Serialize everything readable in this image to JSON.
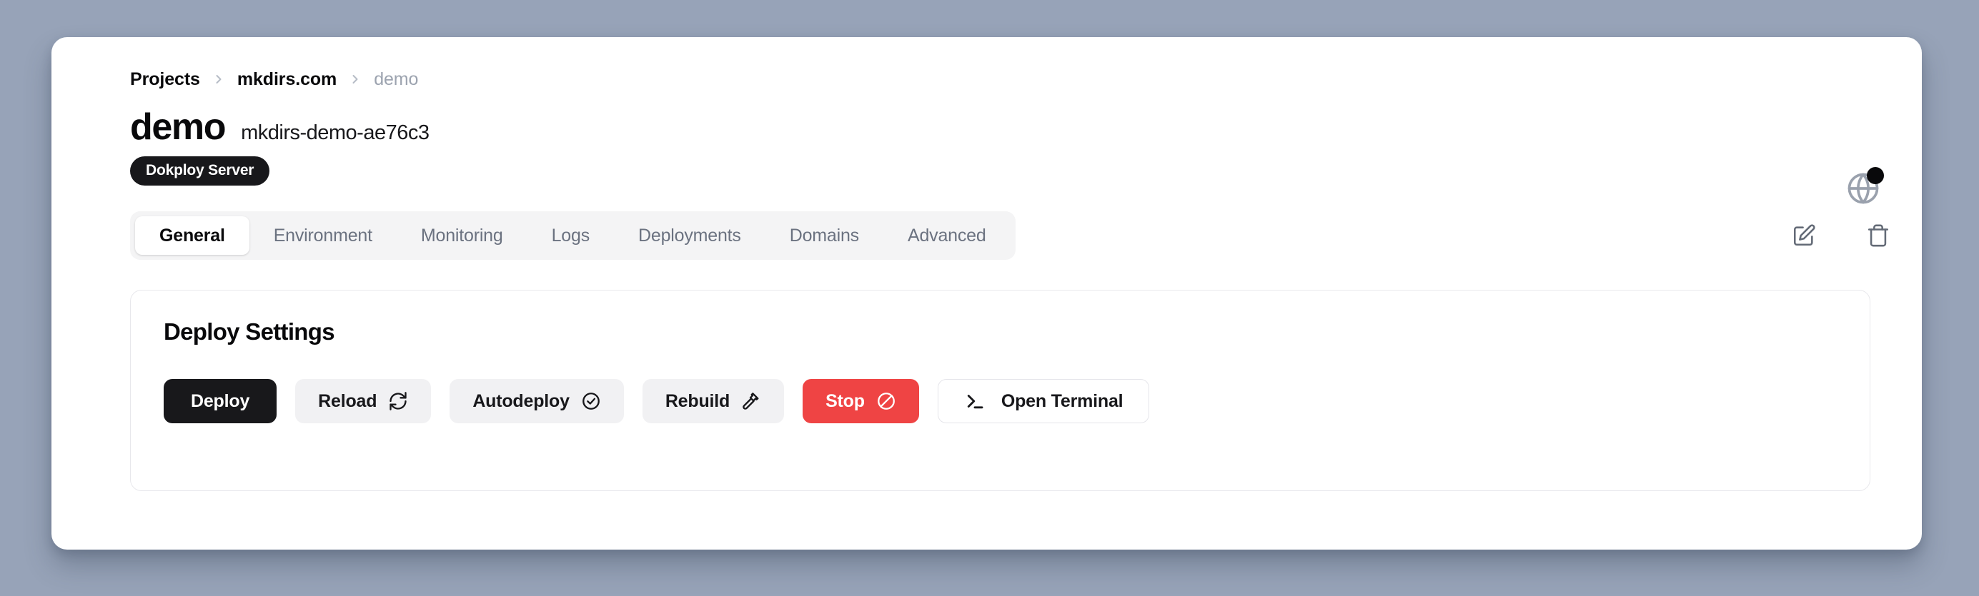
{
  "theme": {
    "page_background": "#97a3b8",
    "card_background": "#ffffff",
    "accent_dark": "#18181b",
    "danger": "#ef4444",
    "muted_text": "#6b7280",
    "panel_border": "#e8e8ec",
    "tabbar_background": "#f4f4f5"
  },
  "breadcrumb": {
    "items": [
      {
        "label": "Projects",
        "muted": false
      },
      {
        "label": "mkdirs.com",
        "muted": false
      },
      {
        "label": "demo",
        "muted": true
      }
    ],
    "separator_icon": "chevron-right-icon"
  },
  "header": {
    "title": "demo",
    "subtitle": "mkdirs-demo-ae76c3",
    "badge": "Dokploy Server",
    "globe_icon": "globe-icon",
    "globe_status_dot": "status-dot"
  },
  "tabs": {
    "items": [
      {
        "label": "General",
        "active": true
      },
      {
        "label": "Environment",
        "active": false
      },
      {
        "label": "Monitoring",
        "active": false
      },
      {
        "label": "Logs",
        "active": false
      },
      {
        "label": "Deployments",
        "active": false
      },
      {
        "label": "Domains",
        "active": false
      },
      {
        "label": "Advanced",
        "active": false
      }
    ],
    "actions": [
      {
        "name": "edit-button",
        "icon": "pencil-square-icon"
      },
      {
        "name": "delete-button",
        "icon": "trash-icon"
      }
    ]
  },
  "panel": {
    "title": "Deploy Settings",
    "buttons": [
      {
        "label": "Deploy",
        "icon": null,
        "style": "primary"
      },
      {
        "label": "Reload",
        "icon": "refresh-icon",
        "style": "secondary"
      },
      {
        "label": "Autodeploy",
        "icon": "check-circle-icon",
        "style": "secondary"
      },
      {
        "label": "Rebuild",
        "icon": "hammer-icon",
        "style": "secondary"
      },
      {
        "label": "Stop",
        "icon": "ban-icon",
        "style": "danger"
      },
      {
        "label": "Open Terminal",
        "icon": "terminal-icon",
        "style": "outline"
      }
    ]
  }
}
